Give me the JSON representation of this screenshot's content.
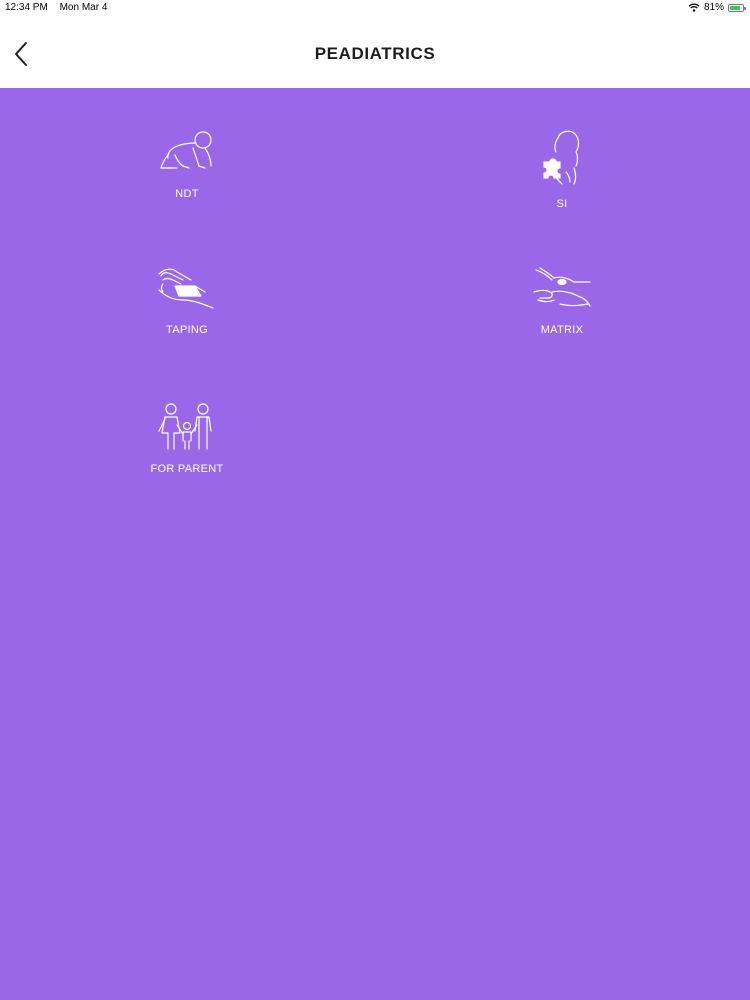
{
  "status_bar": {
    "time": "12:34 PM",
    "date": "Mon Mar 4",
    "battery_percent": "81%",
    "battery_level": 0.81
  },
  "header": {
    "title": "PEADIATRICS",
    "back_icon": "chevron-left-icon"
  },
  "menu": {
    "items": [
      {
        "label": "NDT",
        "icon": "crawling-baby-icon"
      },
      {
        "label": "SI",
        "icon": "puzzle-head-icon"
      },
      {
        "label": "TAPING",
        "icon": "taping-hand-icon"
      },
      {
        "label": "MATRIX",
        "icon": "matrix-hands-icon"
      },
      {
        "label": "FOR PARENT",
        "icon": "family-icon"
      }
    ]
  },
  "colors": {
    "background": "#9a67e8",
    "header_background": "#ffffff",
    "icon_and_label": "#ffffff"
  }
}
